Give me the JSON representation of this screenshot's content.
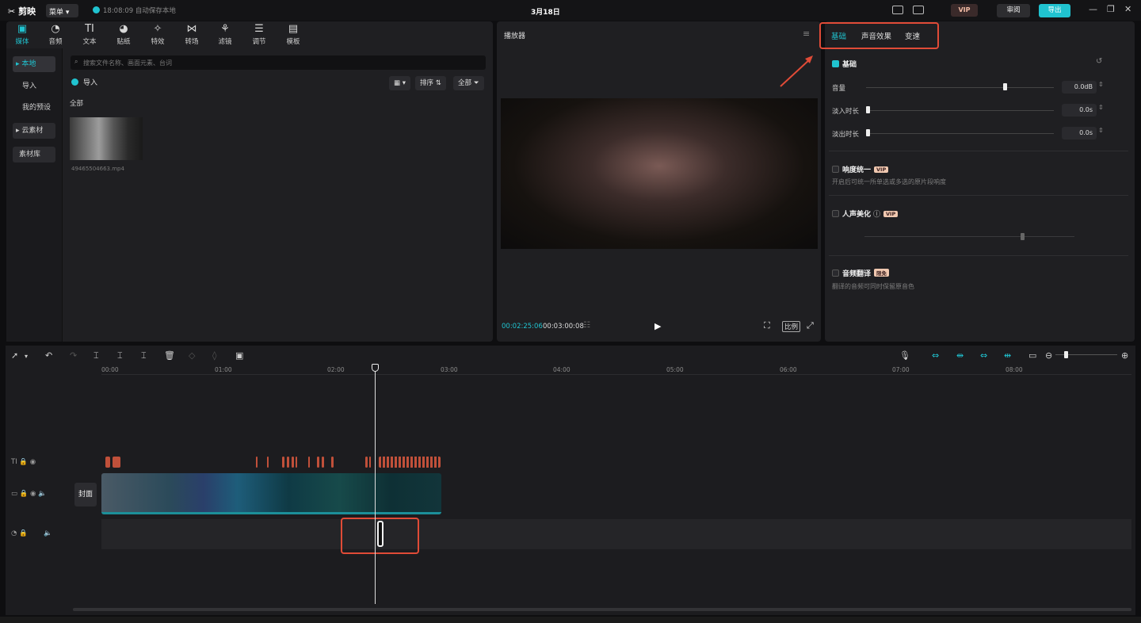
{
  "titlebar": {
    "app_name": "剪映",
    "menu_label": "菜单",
    "save_status": "18:08:09 自动保存本地",
    "project_title": "3月18日",
    "vip_label": "VIP",
    "review_label": "审阅",
    "export_label": "导出"
  },
  "media": {
    "tabs": [
      {
        "icon": "media-icon",
        "label": "媒体"
      },
      {
        "icon": "audio-icon",
        "label": "音频"
      },
      {
        "icon": "text-icon",
        "label": "文本"
      },
      {
        "icon": "sticker-icon",
        "label": "贴纸"
      },
      {
        "icon": "effects-icon",
        "label": "特效"
      },
      {
        "icon": "transition-icon",
        "label": "转场"
      },
      {
        "icon": "filter-icon",
        "label": "滤镜"
      },
      {
        "icon": "adjust-icon",
        "label": "调节"
      },
      {
        "icon": "template-icon",
        "label": "模板"
      }
    ],
    "side": {
      "local": "本地",
      "import": "导入",
      "my_presets": "我的预设",
      "cloud": "云素材",
      "library": "素材库"
    },
    "search_placeholder": "搜索文件名称、画面元素、台词",
    "import_button": "导入",
    "sort_label": "排序",
    "filter_label": "全部",
    "all_label": "全部",
    "file_name": "49465504663.mp4"
  },
  "player": {
    "title": "播放器",
    "current_time": "00:02:25:06",
    "total_time": "00:03:00:08",
    "ratio_label": "比例"
  },
  "props": {
    "tabs": [
      "基础",
      "声音效果",
      "变速"
    ],
    "basic_section": "基础",
    "volume_label": "音量",
    "volume_value": "0.0dB",
    "fade_in_label": "淡入时长",
    "fade_in_value": "0.0s",
    "fade_out_label": "淡出时长",
    "fade_out_value": "0.0s",
    "loudness_label": "响度统一",
    "loudness_desc": "开启后可统一所单选或多选的原片段响度",
    "voice_beauty_label": "人声美化",
    "translate_label": "音频翻译",
    "translate_badge": "限免",
    "translate_desc": "翻译的音频可同时保留原音色",
    "vip_badge": "VIP"
  },
  "timeline": {
    "ruler": [
      "00:00",
      "01:00",
      "02:00",
      "03:00",
      "04:00",
      "05:00",
      "06:00",
      "07:00",
      "08:00"
    ],
    "cover_label": "封面",
    "text_track_icon": "TI"
  },
  "colors": {
    "accent": "#20c3d0",
    "annotation_red": "#e04b37",
    "clip_text": "#c0503a"
  }
}
